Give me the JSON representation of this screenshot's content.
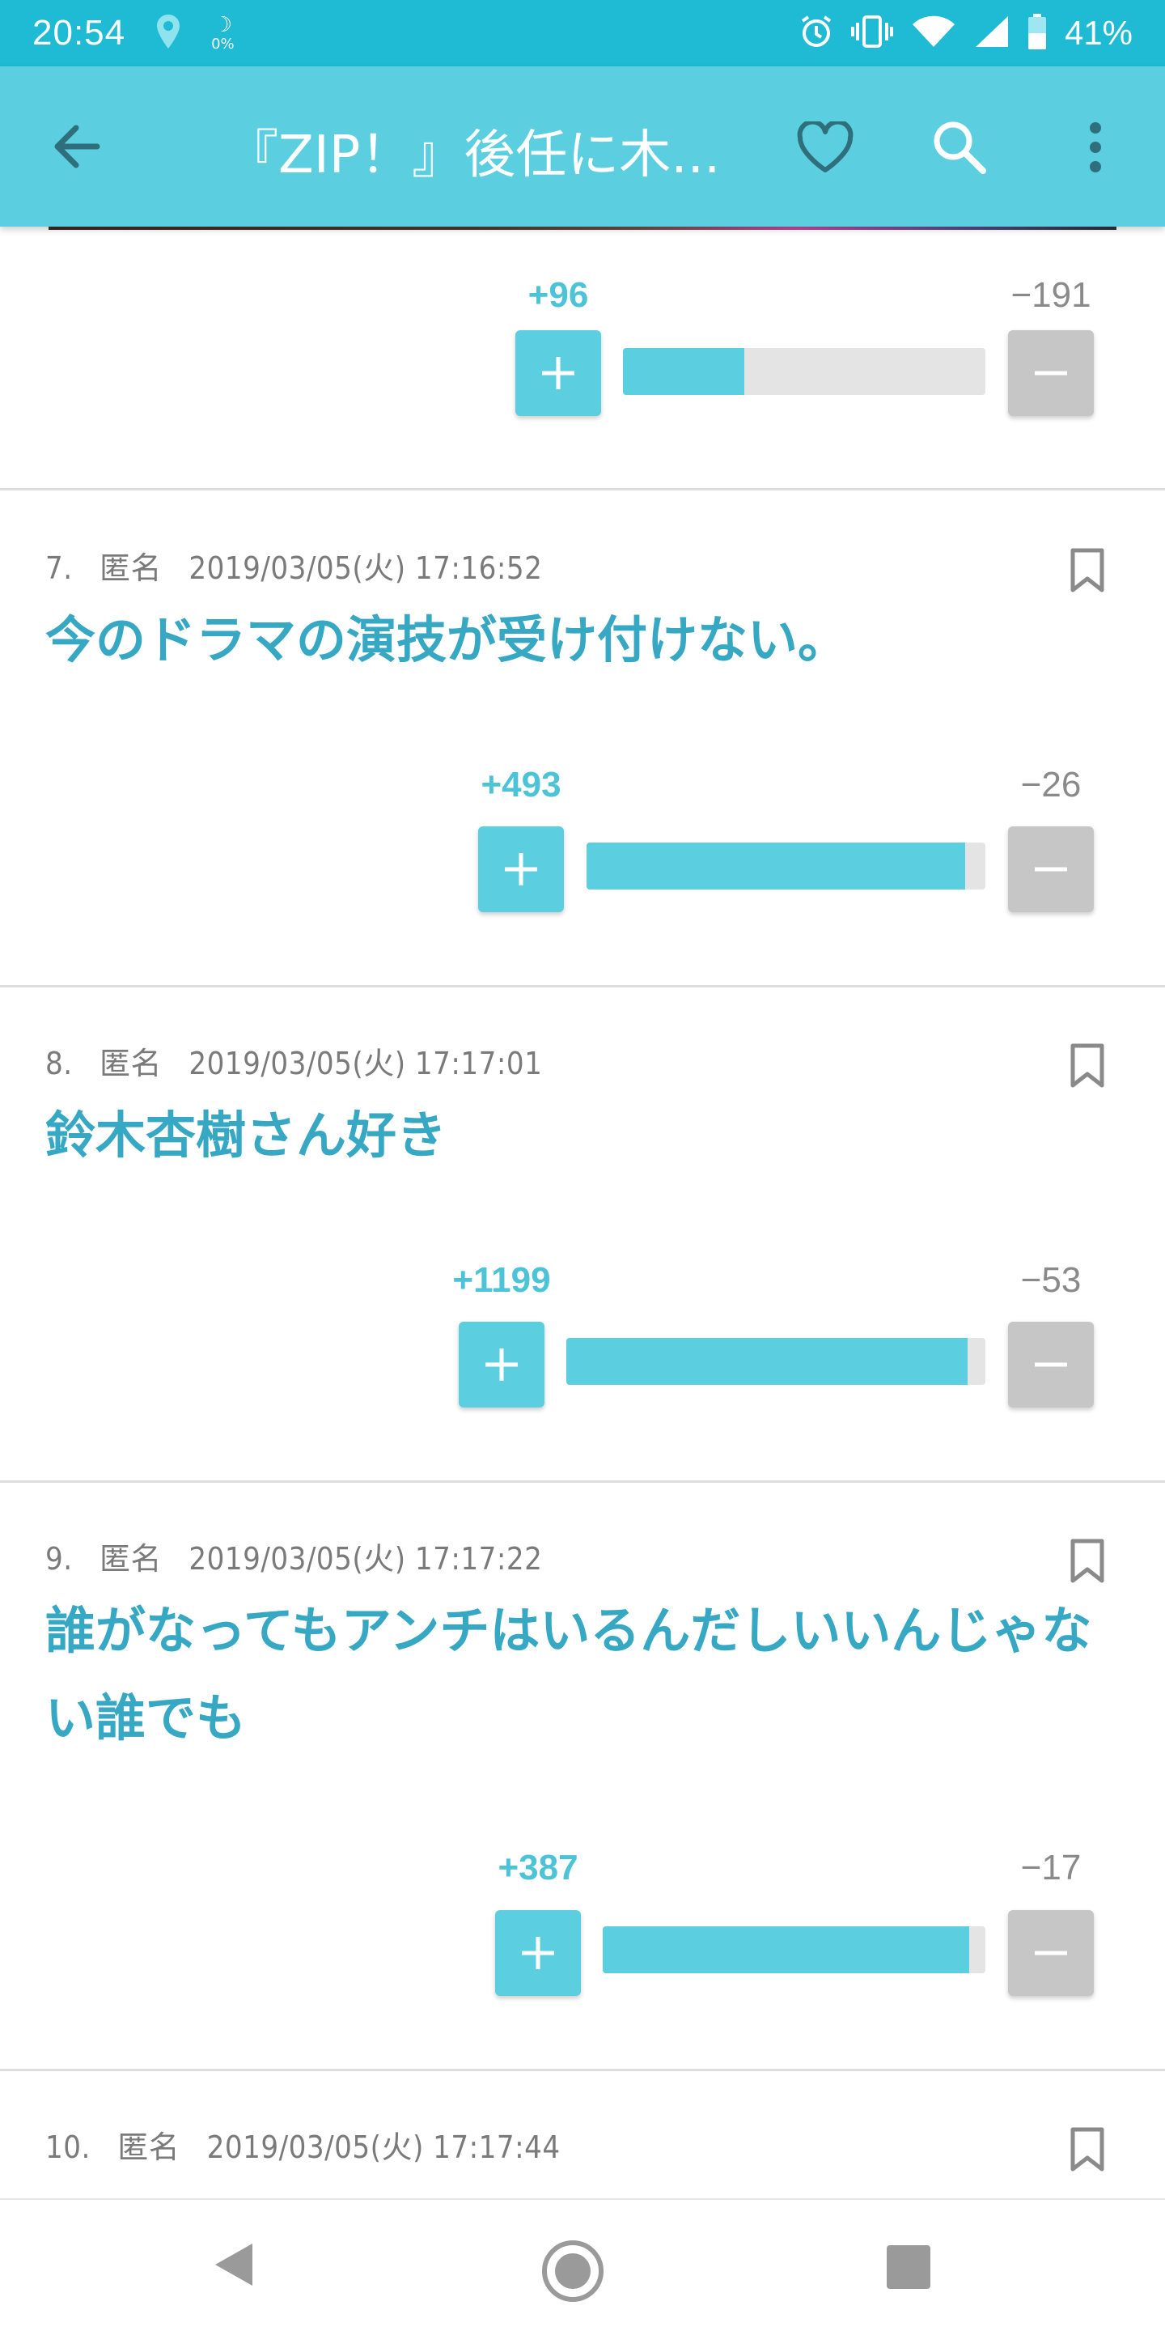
{
  "status_bar": {
    "time": "20:54",
    "data_saver_percent": "0%",
    "battery": "41%"
  },
  "app_bar": {
    "title": "『ZIP！』後任に木..."
  },
  "colors": {
    "accent": "#5bcfe0",
    "status_bar": "#1fbad4",
    "comment_text": "#36a8c3",
    "minus_button": "#c6c6c6"
  },
  "comments": [
    {
      "number": "",
      "author": "",
      "datetime": "",
      "text": "",
      "plus": "+96",
      "minus": "−191",
      "plus_fraction": 0.334
    },
    {
      "number": "7.",
      "author": "匿名",
      "datetime": "2019/03/05(火)  17:16:52",
      "text": "今のドラマの演技が受け付けない。",
      "plus": "+493",
      "minus": "−26",
      "plus_fraction": 0.95
    },
    {
      "number": "8.",
      "author": "匿名",
      "datetime": "2019/03/05(火)  17:17:01",
      "text": "鈴木杏樹さん好き",
      "plus": "+1199",
      "minus": "−53",
      "plus_fraction": 0.958
    },
    {
      "number": "9.",
      "author": "匿名",
      "datetime": "2019/03/05(火)  17:17:22",
      "text": "誰がなってもアンチはいるんだしいいんじゃない誰でも",
      "plus": "+387",
      "minus": "−17",
      "plus_fraction": 0.958
    },
    {
      "number": "10.",
      "author": "匿名",
      "datetime": "2019/03/05(火)  17:17:44",
      "text": "",
      "plus": "",
      "minus": "",
      "plus_fraction": 0
    }
  ]
}
